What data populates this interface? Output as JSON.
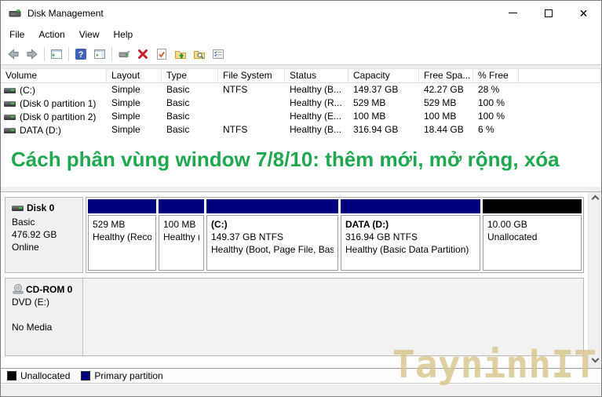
{
  "window": {
    "title": "Disk Management",
    "controls": {
      "minimize": "minimize",
      "maximize": "maximize",
      "close": "close"
    }
  },
  "menu": {
    "items": [
      "File",
      "Action",
      "View",
      "Help"
    ]
  },
  "toolbar": {
    "icons": [
      "back",
      "forward",
      "show-console-tree",
      "help",
      "show-action-pane",
      "device-status",
      "delete",
      "check-document",
      "folder-up",
      "folder-search",
      "properties-list"
    ]
  },
  "volume_table": {
    "columns": [
      "Volume",
      "Layout",
      "Type",
      "File System",
      "Status",
      "Capacity",
      "Free Spa...",
      "% Free"
    ],
    "rows": [
      {
        "volume": "(C:)",
        "layout": "Simple",
        "type": "Basic",
        "fs": "NTFS",
        "status": "Healthy (B...",
        "capacity": "149.37 GB",
        "free": "42.27 GB",
        "pct": "28 %"
      },
      {
        "volume": "(Disk 0 partition 1)",
        "layout": "Simple",
        "type": "Basic",
        "fs": "",
        "status": "Healthy (R...",
        "capacity": "529 MB",
        "free": "529 MB",
        "pct": "100 %"
      },
      {
        "volume": "(Disk 0 partition 2)",
        "layout": "Simple",
        "type": "Basic",
        "fs": "",
        "status": "Healthy (E...",
        "capacity": "100 MB",
        "free": "100 MB",
        "pct": "100 %"
      },
      {
        "volume": "DATA (D:)",
        "layout": "Simple",
        "type": "Basic",
        "fs": "NTFS",
        "status": "Healthy (B...",
        "capacity": "316.94 GB",
        "free": "18.44 GB",
        "pct": "6 %"
      }
    ]
  },
  "headline": {
    "text": "Cách phân vùng window 7/8/10: thêm mới, mở rộng, xóa",
    "color": "#1fa84e"
  },
  "disk0": {
    "name": "Disk 0",
    "kind": "Basic",
    "size": "476.92 GB",
    "status": "Online",
    "partitions": [
      {
        "title": "",
        "size": "529 MB",
        "status": "Healthy (Reco",
        "kind": "primary"
      },
      {
        "title": "",
        "size": "100 MB",
        "status": "Healthy (",
        "kind": "primary"
      },
      {
        "title": "(C:)",
        "size": "149.37 GB NTFS",
        "status": "Healthy (Boot, Page File, Basi",
        "kind": "primary"
      },
      {
        "title": "DATA (D:)",
        "size": "316.94 GB NTFS",
        "status": "Healthy (Basic Data Partition)",
        "kind": "primary"
      },
      {
        "title": "",
        "size": "10.00 GB",
        "status": "Unallocated",
        "kind": "unallocated"
      }
    ]
  },
  "cdrom": {
    "name": "CD-ROM 0",
    "drive": "DVD (E:)",
    "media": "No Media"
  },
  "legend": {
    "items": [
      {
        "label": "Unallocated",
        "color": "#000000"
      },
      {
        "label": "Primary partition",
        "color": "#00007f"
      }
    ]
  },
  "watermark": {
    "text": "TayninhIT",
    "color": "#d8c58e"
  }
}
